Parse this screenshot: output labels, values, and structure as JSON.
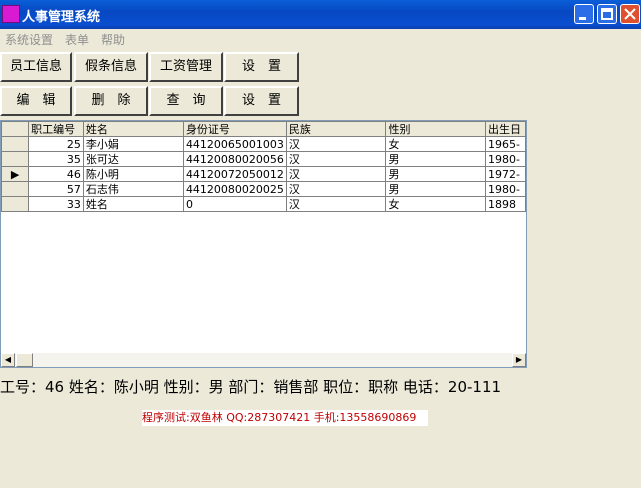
{
  "window": {
    "title": "人事管理系统"
  },
  "menu": {
    "items": [
      "系统设置",
      "表单",
      "帮助"
    ]
  },
  "toolbar1": {
    "buttons": [
      "员工信息",
      "假条信息",
      "工资管理",
      "设　置"
    ]
  },
  "toolbar2": {
    "buttons": [
      "编　辑",
      "删　除",
      "查　询",
      "设　置"
    ]
  },
  "grid": {
    "columns": [
      "职工编号",
      "姓名",
      "身份证号",
      "民族",
      "性别",
      "出生日"
    ],
    "rows": [
      [
        "25",
        "李小娟",
        "44120065001003",
        "汉",
        "女",
        "1965-"
      ],
      [
        "35",
        "张可达",
        "44120080020056",
        "汉",
        "男",
        "1980-"
      ],
      [
        "46",
        "陈小明",
        "44120072050012",
        "汉",
        "男",
        "1972-"
      ],
      [
        "57",
        "石志伟",
        "44120080020025",
        "汉",
        "男",
        "1980-"
      ],
      [
        "33",
        "姓名",
        "0",
        "汉",
        "女",
        "1898"
      ]
    ],
    "current_row_marker": "▶",
    "current_row_index": 2
  },
  "info_line": "工号：46 姓名：陈小明 性别：男 部门：销售部 职位：职称 电话：20-111",
  "credit": "程序测试:双鱼林 QQ:287307421 手机:13558690869",
  "colors": {
    "title_bar": "#0748c2",
    "credit_text": "#c00000",
    "app_icon": "#d81bd2"
  }
}
